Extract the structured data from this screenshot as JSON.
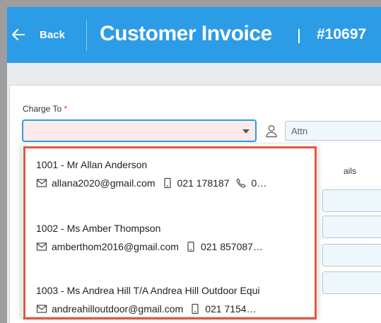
{
  "header": {
    "back_label": "Back",
    "title": "Customer Invoice",
    "invoice_number": "#10697"
  },
  "form": {
    "charge_to_label": "Charge To",
    "required_marker": "*",
    "attn_placeholder": "Attn",
    "details_label_fragment": "ails"
  },
  "dropdown": {
    "options": [
      {
        "title": "1001 - Mr Allan Anderson",
        "email": "allana2020@gmail.com",
        "mobile": "021 178187",
        "phone": "0…"
      },
      {
        "title": "1002 - Ms Amber Thompson",
        "email": "amberthom2016@gmail.com",
        "mobile": "021 857087…"
      },
      {
        "title": "1003 - Ms Andrea Hill T/A Andrea Hill Outdoor Equi",
        "email": "andreahilloutdoor@gmail.com",
        "mobile": "021 7154…"
      }
    ]
  },
  "colors": {
    "header_bg": "#2c9ce6",
    "highlight_border": "#e0593b",
    "select_bg": "#fde9ea",
    "required": "#e53935"
  },
  "icons": [
    "arrow-left-icon",
    "person-icon",
    "email-icon",
    "mobile-icon",
    "phone-icon"
  ]
}
